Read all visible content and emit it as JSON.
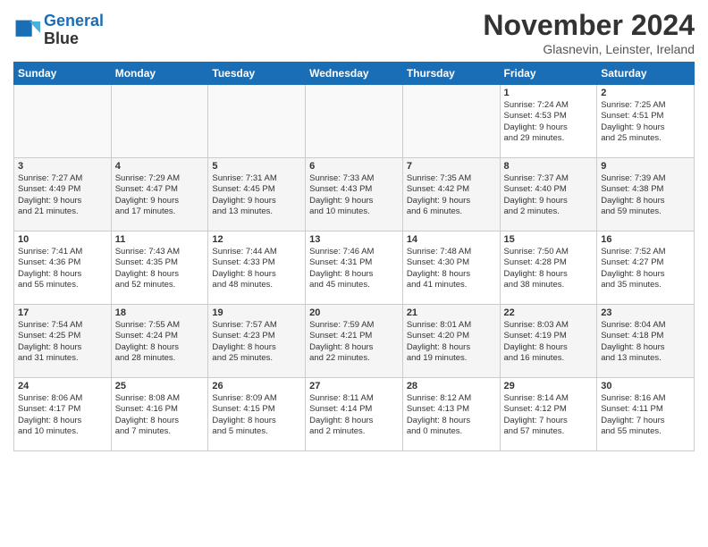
{
  "header": {
    "logo_line1": "General",
    "logo_line2": "Blue",
    "month": "November 2024",
    "location": "Glasnevin, Leinster, Ireland"
  },
  "days_of_week": [
    "Sunday",
    "Monday",
    "Tuesday",
    "Wednesday",
    "Thursday",
    "Friday",
    "Saturday"
  ],
  "weeks": [
    [
      {
        "day": "",
        "info": ""
      },
      {
        "day": "",
        "info": ""
      },
      {
        "day": "",
        "info": ""
      },
      {
        "day": "",
        "info": ""
      },
      {
        "day": "",
        "info": ""
      },
      {
        "day": "1",
        "info": "Sunrise: 7:24 AM\nSunset: 4:53 PM\nDaylight: 9 hours\nand 29 minutes."
      },
      {
        "day": "2",
        "info": "Sunrise: 7:25 AM\nSunset: 4:51 PM\nDaylight: 9 hours\nand 25 minutes."
      }
    ],
    [
      {
        "day": "3",
        "info": "Sunrise: 7:27 AM\nSunset: 4:49 PM\nDaylight: 9 hours\nand 21 minutes."
      },
      {
        "day": "4",
        "info": "Sunrise: 7:29 AM\nSunset: 4:47 PM\nDaylight: 9 hours\nand 17 minutes."
      },
      {
        "day": "5",
        "info": "Sunrise: 7:31 AM\nSunset: 4:45 PM\nDaylight: 9 hours\nand 13 minutes."
      },
      {
        "day": "6",
        "info": "Sunrise: 7:33 AM\nSunset: 4:43 PM\nDaylight: 9 hours\nand 10 minutes."
      },
      {
        "day": "7",
        "info": "Sunrise: 7:35 AM\nSunset: 4:42 PM\nDaylight: 9 hours\nand 6 minutes."
      },
      {
        "day": "8",
        "info": "Sunrise: 7:37 AM\nSunset: 4:40 PM\nDaylight: 9 hours\nand 2 minutes."
      },
      {
        "day": "9",
        "info": "Sunrise: 7:39 AM\nSunset: 4:38 PM\nDaylight: 8 hours\nand 59 minutes."
      }
    ],
    [
      {
        "day": "10",
        "info": "Sunrise: 7:41 AM\nSunset: 4:36 PM\nDaylight: 8 hours\nand 55 minutes."
      },
      {
        "day": "11",
        "info": "Sunrise: 7:43 AM\nSunset: 4:35 PM\nDaylight: 8 hours\nand 52 minutes."
      },
      {
        "day": "12",
        "info": "Sunrise: 7:44 AM\nSunset: 4:33 PM\nDaylight: 8 hours\nand 48 minutes."
      },
      {
        "day": "13",
        "info": "Sunrise: 7:46 AM\nSunset: 4:31 PM\nDaylight: 8 hours\nand 45 minutes."
      },
      {
        "day": "14",
        "info": "Sunrise: 7:48 AM\nSunset: 4:30 PM\nDaylight: 8 hours\nand 41 minutes."
      },
      {
        "day": "15",
        "info": "Sunrise: 7:50 AM\nSunset: 4:28 PM\nDaylight: 8 hours\nand 38 minutes."
      },
      {
        "day": "16",
        "info": "Sunrise: 7:52 AM\nSunset: 4:27 PM\nDaylight: 8 hours\nand 35 minutes."
      }
    ],
    [
      {
        "day": "17",
        "info": "Sunrise: 7:54 AM\nSunset: 4:25 PM\nDaylight: 8 hours\nand 31 minutes."
      },
      {
        "day": "18",
        "info": "Sunrise: 7:55 AM\nSunset: 4:24 PM\nDaylight: 8 hours\nand 28 minutes."
      },
      {
        "day": "19",
        "info": "Sunrise: 7:57 AM\nSunset: 4:23 PM\nDaylight: 8 hours\nand 25 minutes."
      },
      {
        "day": "20",
        "info": "Sunrise: 7:59 AM\nSunset: 4:21 PM\nDaylight: 8 hours\nand 22 minutes."
      },
      {
        "day": "21",
        "info": "Sunrise: 8:01 AM\nSunset: 4:20 PM\nDaylight: 8 hours\nand 19 minutes."
      },
      {
        "day": "22",
        "info": "Sunrise: 8:03 AM\nSunset: 4:19 PM\nDaylight: 8 hours\nand 16 minutes."
      },
      {
        "day": "23",
        "info": "Sunrise: 8:04 AM\nSunset: 4:18 PM\nDaylight: 8 hours\nand 13 minutes."
      }
    ],
    [
      {
        "day": "24",
        "info": "Sunrise: 8:06 AM\nSunset: 4:17 PM\nDaylight: 8 hours\nand 10 minutes."
      },
      {
        "day": "25",
        "info": "Sunrise: 8:08 AM\nSunset: 4:16 PM\nDaylight: 8 hours\nand 7 minutes."
      },
      {
        "day": "26",
        "info": "Sunrise: 8:09 AM\nSunset: 4:15 PM\nDaylight: 8 hours\nand 5 minutes."
      },
      {
        "day": "27",
        "info": "Sunrise: 8:11 AM\nSunset: 4:14 PM\nDaylight: 8 hours\nand 2 minutes."
      },
      {
        "day": "28",
        "info": "Sunrise: 8:12 AM\nSunset: 4:13 PM\nDaylight: 8 hours\nand 0 minutes."
      },
      {
        "day": "29",
        "info": "Sunrise: 8:14 AM\nSunset: 4:12 PM\nDaylight: 7 hours\nand 57 minutes."
      },
      {
        "day": "30",
        "info": "Sunrise: 8:16 AM\nSunset: 4:11 PM\nDaylight: 7 hours\nand 55 minutes."
      }
    ]
  ]
}
